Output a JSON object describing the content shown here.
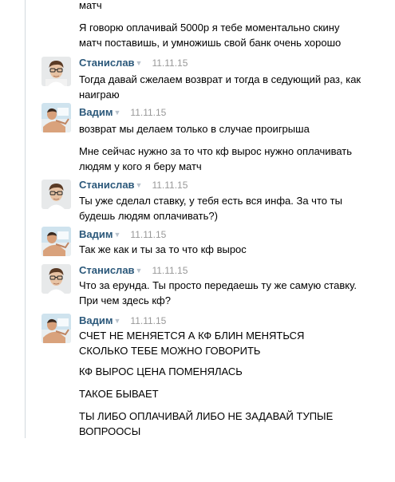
{
  "intro": {
    "line1": "матч",
    "line2": "Я говорю оплачивай 5000р я тебе моментально скину матч поставишь, и умножишь свой банк очень хорошо"
  },
  "messages": [
    {
      "author": "Станислав",
      "date": "11.11.15",
      "avatar": "stanislav-avatar",
      "texts": [
        "Тогда давай сжелаем возврат и тогда в седующий раз, как наиграю"
      ]
    },
    {
      "author": "Вадим",
      "date": "11.11.15",
      "avatar": "vadim-avatar",
      "texts": [
        "возврат мы делаем только в случае проигрыша",
        "Мне сейчас нужно за то что кф вырос нужно оплачивать людям у кого я беру матч"
      ]
    },
    {
      "author": "Станислав",
      "date": "11.11.15",
      "avatar": "stanislav-avatar",
      "texts": [
        "Ты уже сделал ставку, у тебя есть вся инфа. За что ты будешь людям оплачивать?)"
      ]
    },
    {
      "author": "Вадим",
      "date": "11.11.15",
      "avatar": "vadim-avatar",
      "texts": [
        "Так же как и ты за то что кф вырос"
      ]
    },
    {
      "author": "Станислав",
      "date": "11.11.15",
      "avatar": "stanislav-avatar",
      "texts": [
        "Что за ерунда. Ты просто передаешь ту же самую ставку. При чем здесь кф?"
      ]
    },
    {
      "author": "Вадим",
      "date": "11.11.15",
      "avatar": "vadim-avatar",
      "texts": [
        "СЧЕТ НЕ МЕНЯЕТСЯ А КФ БЛИН МЕНЯТЬСЯ СКОЛЬКО ТЕБЕ МОЖНО ГОВОРИТЬ",
        "КФ ВЫРОС ЦЕНА ПОМЕНЯЛАСЬ",
        "ТАКОЕ БЫВАЕТ",
        "ТЫ ЛИБО ОПЛАЧИВАЙ ЛИБО НЕ ЗАДАВАЙ ТУПЫЕ ВОПРООСЫ"
      ]
    }
  ]
}
